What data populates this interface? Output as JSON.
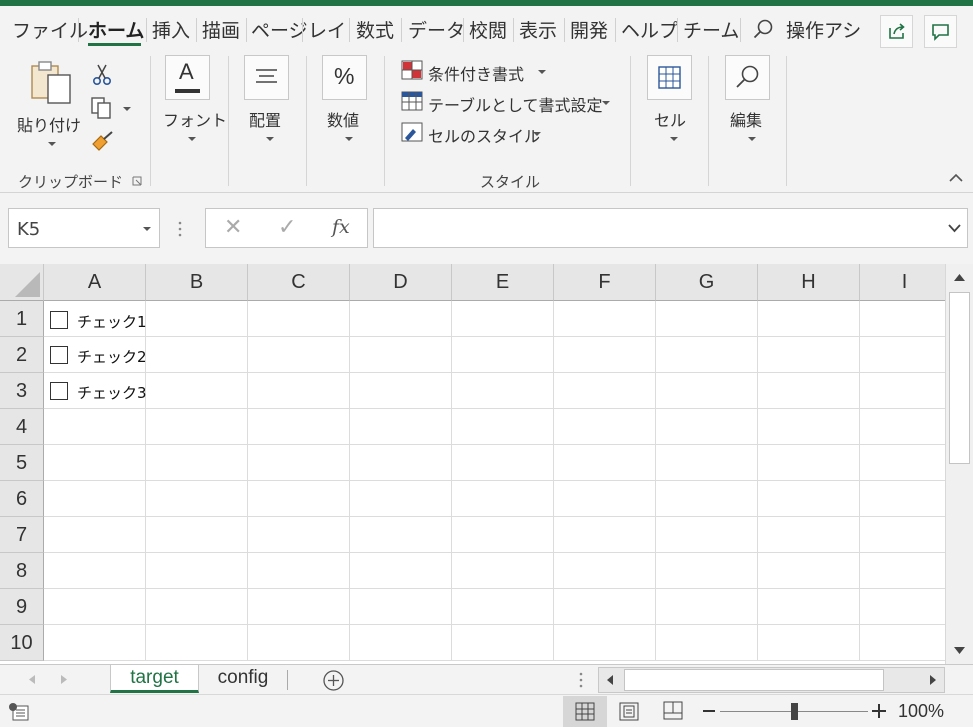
{
  "ribbon_tabs": [
    "ファイル",
    "ホーム",
    "挿入",
    "描画",
    "ページ",
    "レイ",
    "数式",
    "データ",
    "校閲",
    "表示",
    "開発",
    "ヘルプ",
    "チーム"
  ],
  "active_tab": "ホーム",
  "tell_me": "操作アシ",
  "ribbon": {
    "clipboard": {
      "paste_label": "貼り付け",
      "group_label": "クリップボード"
    },
    "font": {
      "label": "フォント",
      "icon_letter": "A"
    },
    "alignment": {
      "label": "配置"
    },
    "number": {
      "label": "数値",
      "icon_symbol": "%"
    },
    "styles": {
      "conditional_formatting": "条件付き書式",
      "format_as_table": "テーブルとして書式設定",
      "cell_styles": "セルのスタイル",
      "group_label": "スタイル"
    },
    "cells": {
      "label": "セル"
    },
    "editing": {
      "label": "編集"
    }
  },
  "formula_bar": {
    "name_box": "K5",
    "formula_value": "",
    "cancel_symbol": "✕",
    "enter_symbol": "✓",
    "fx_symbol": "fx"
  },
  "columns": [
    "A",
    "B",
    "C",
    "D",
    "E",
    "F",
    "G",
    "H",
    "I"
  ],
  "rows": [
    "1",
    "2",
    "3",
    "4",
    "5",
    "6",
    "7",
    "8",
    "9",
    "10"
  ],
  "checkboxes": [
    {
      "label": "チェック1",
      "checked": false
    },
    {
      "label": "チェック2",
      "checked": false
    },
    {
      "label": "チェック3",
      "checked": false
    }
  ],
  "sheets": [
    {
      "name": "target",
      "active": true
    },
    {
      "name": "config",
      "active": false
    }
  ],
  "status_bar": {
    "zoom_percent": "100%",
    "zoom_level": 1.0,
    "active_view": "normal"
  },
  "colors": {
    "accent": "#217346",
    "grid_line": "#dcdcdc",
    "header_bg": "#e6e6e6"
  }
}
